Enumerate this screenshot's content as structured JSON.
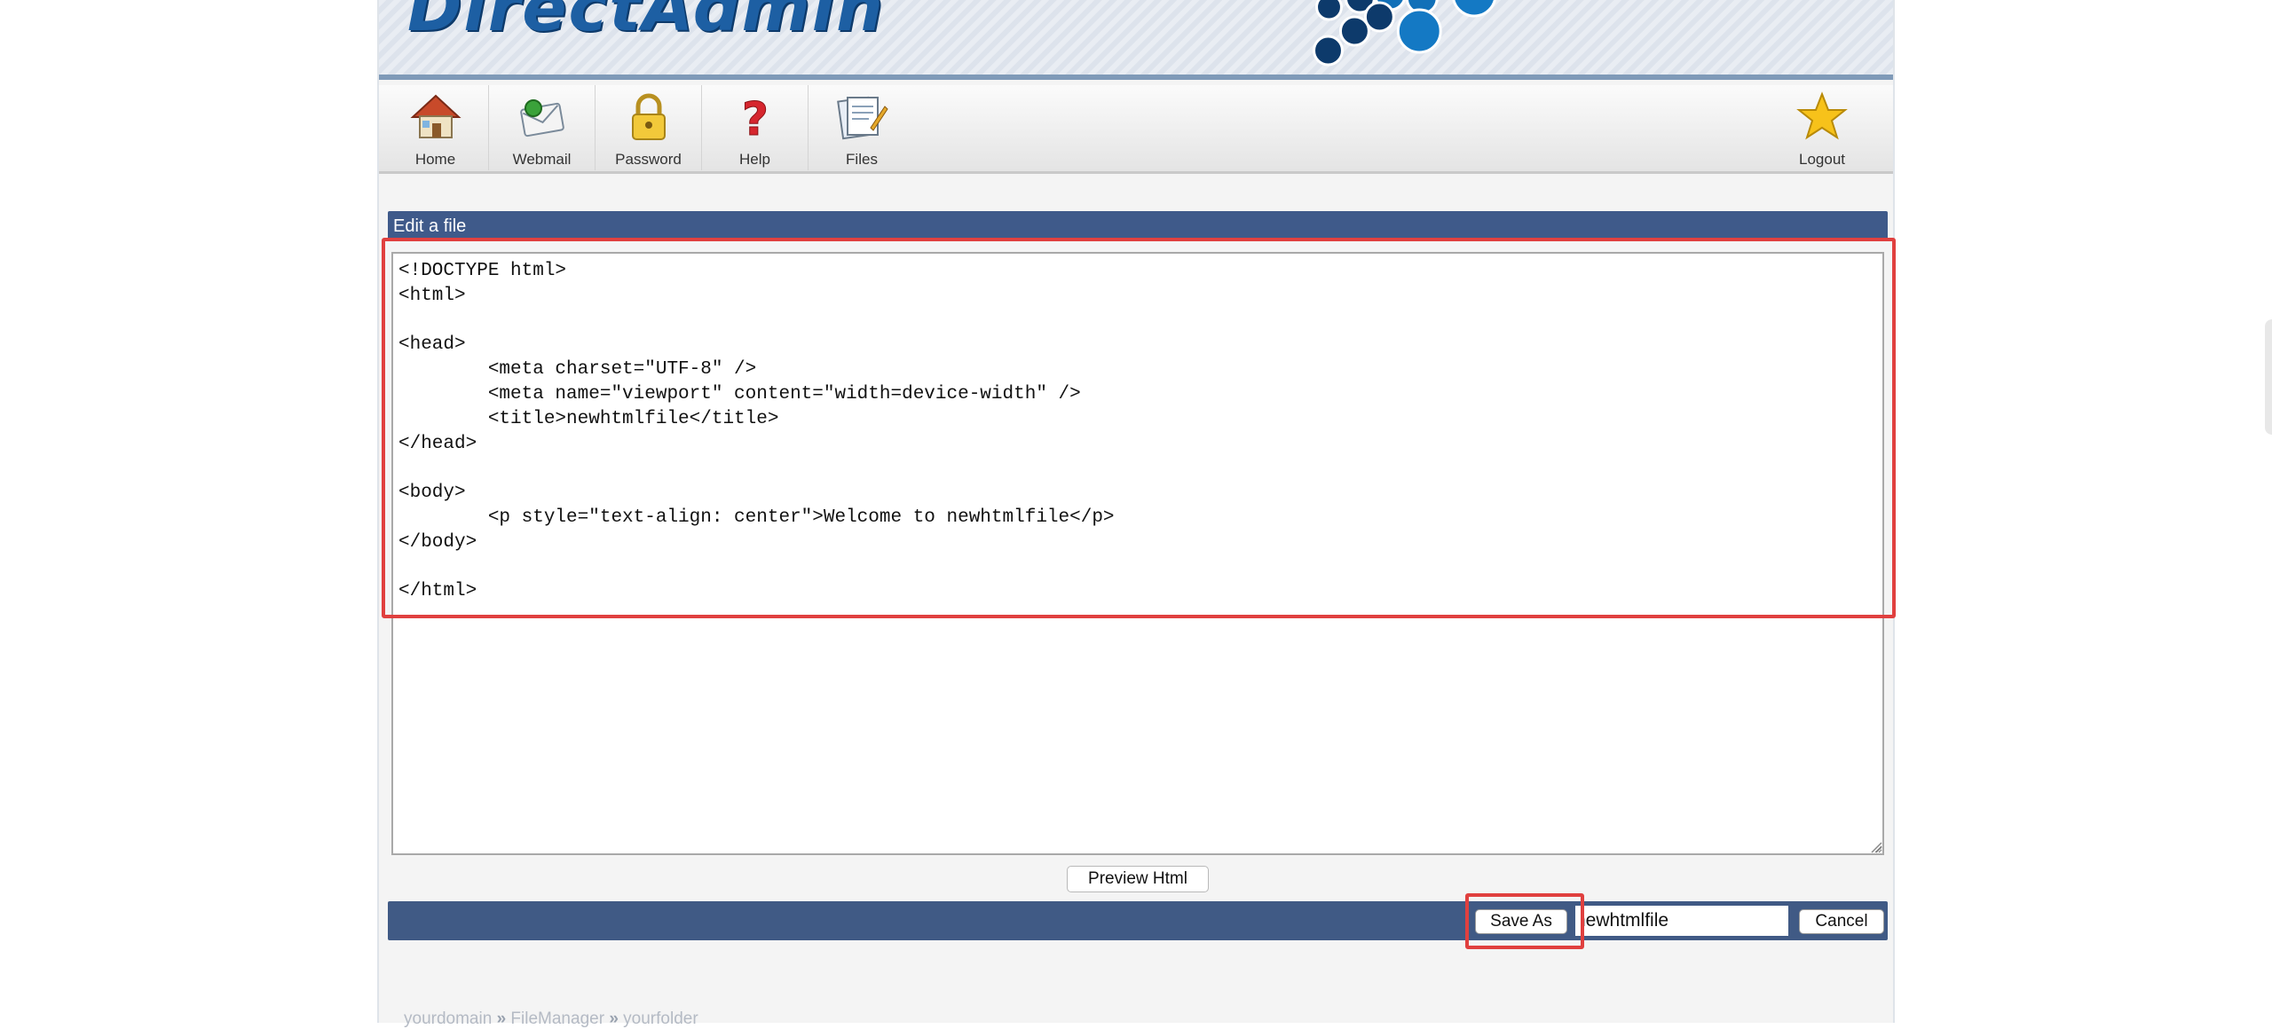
{
  "app": {
    "logo_text": "DirectAdmin"
  },
  "toolbar": {
    "items": [
      {
        "label": "Home",
        "icon": "home-icon"
      },
      {
        "label": "Webmail",
        "icon": "webmail-icon"
      },
      {
        "label": "Password",
        "icon": "lock-icon"
      },
      {
        "label": "Help",
        "icon": "help-icon"
      },
      {
        "label": "Files",
        "icon": "files-icon"
      }
    ],
    "logout": {
      "label": "Logout",
      "icon": "star-icon"
    }
  },
  "section": {
    "title": "Edit a file"
  },
  "editor": {
    "content": "<!DOCTYPE html>\n<html>\n\n<head>\n        <meta charset=\"UTF-8\" />\n        <meta name=\"viewport\" content=\"width=device-width\" />\n        <title>newhtmlfile</title>\n</head>\n\n<body>\n        <p style=\"text-align: center\">Welcome to newhtmlfile</p>\n</body>\n\n</html>"
  },
  "actions": {
    "preview_label": "Preview Html",
    "save_as_label": "Save As",
    "filename_value": "newhtmlfile",
    "cancel_label": "Cancel"
  },
  "breadcrumb": {
    "items": [
      "yourdomain",
      "FileManager",
      "yourfolder"
    ],
    "separator": "»"
  },
  "colors": {
    "header_bar": "#3f5a8a",
    "highlight": "#e0403f",
    "brand_blue": "#1d5fa3"
  }
}
